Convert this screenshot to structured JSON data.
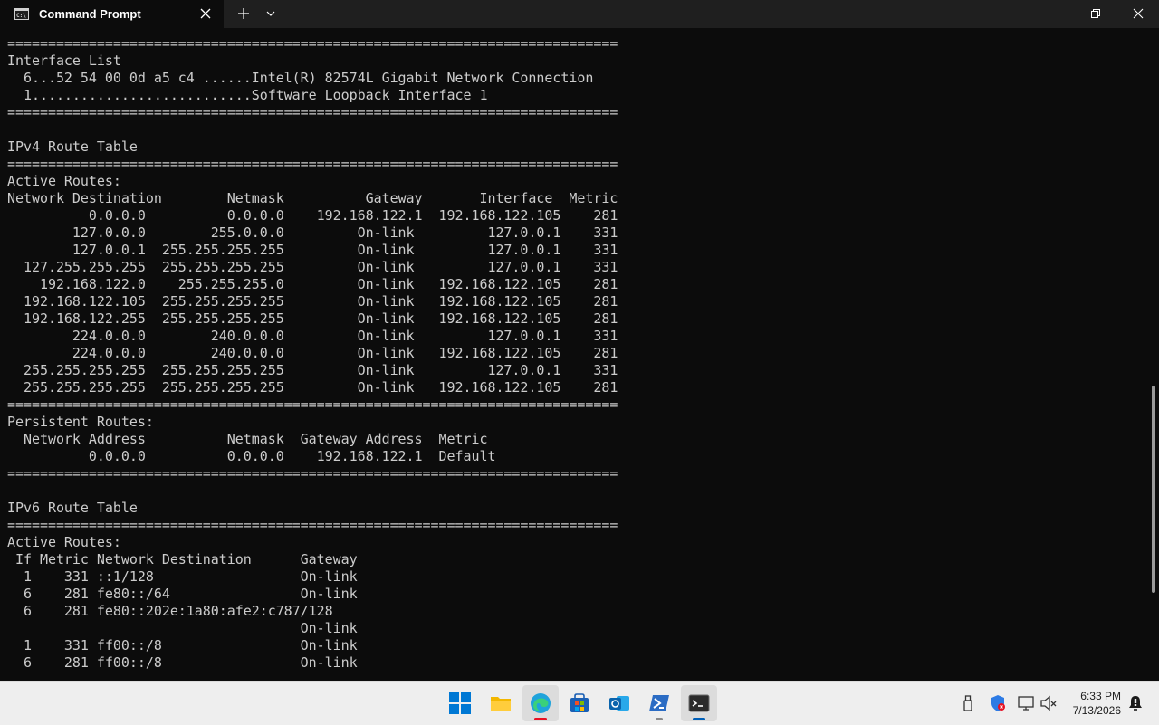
{
  "window": {
    "tab_title": "Command Prompt",
    "tab_icon": "cmd-icon",
    "buttons": [
      "close-tab",
      "new-tab",
      "dropdown",
      "minimize",
      "maximize",
      "close"
    ]
  },
  "terminal": {
    "lines": [
      "===========================================================================",
      "Interface List",
      "  6...52 54 00 0d a5 c4 ......Intel(R) 82574L Gigabit Network Connection",
      "  1...........................Software Loopback Interface 1",
      "===========================================================================",
      "",
      "IPv4 Route Table",
      "===========================================================================",
      "Active Routes:",
      "Network Destination        Netmask          Gateway       Interface  Metric",
      "          0.0.0.0          0.0.0.0    192.168.122.1  192.168.122.105    281",
      "        127.0.0.0        255.0.0.0         On-link         127.0.0.1    331",
      "        127.0.0.1  255.255.255.255         On-link         127.0.0.1    331",
      "  127.255.255.255  255.255.255.255         On-link         127.0.0.1    331",
      "    192.168.122.0    255.255.255.0         On-link   192.168.122.105    281",
      "  192.168.122.105  255.255.255.255         On-link   192.168.122.105    281",
      "  192.168.122.255  255.255.255.255         On-link   192.168.122.105    281",
      "        224.0.0.0        240.0.0.0         On-link         127.0.0.1    331",
      "        224.0.0.0        240.0.0.0         On-link   192.168.122.105    281",
      "  255.255.255.255  255.255.255.255         On-link         127.0.0.1    331",
      "  255.255.255.255  255.255.255.255         On-link   192.168.122.105    281",
      "===========================================================================",
      "Persistent Routes:",
      "  Network Address          Netmask  Gateway Address  Metric",
      "          0.0.0.0          0.0.0.0    192.168.122.1  Default",
      "===========================================================================",
      "",
      "IPv6 Route Table",
      "===========================================================================",
      "Active Routes:",
      " If Metric Network Destination      Gateway",
      "  1    331 ::1/128                  On-link",
      "  6    281 fe80::/64                On-link",
      "  6    281 fe80::202e:1a80:afe2:c787/128",
      "                                    On-link",
      "  1    331 ff00::/8                 On-link",
      "  6    281 ff00::/8                 On-link"
    ]
  },
  "taskbar": {
    "apps": [
      {
        "name": "start-icon",
        "active": false
      },
      {
        "name": "file-explorer-icon",
        "active": false
      },
      {
        "name": "edge-icon",
        "active": true
      },
      {
        "name": "microsoft-store-icon",
        "active": false
      },
      {
        "name": "outlook-icon",
        "active": false
      },
      {
        "name": "powershell-icon",
        "active": false
      },
      {
        "name": "terminal-icon",
        "active": true
      }
    ],
    "tray_icons": [
      "usb-icon",
      "security-icon",
      "network-icon",
      "volume-muted-icon",
      "notification-icon"
    ],
    "time": "6:33 PM",
    "date": "7/13/2026"
  },
  "colors": {
    "terminal_background": "#0c0c0c",
    "terminal_text": "#cccccc",
    "titlebar": "#1f1f1f",
    "taskbar": "#eeeeee",
    "accent": "#005fb8"
  }
}
